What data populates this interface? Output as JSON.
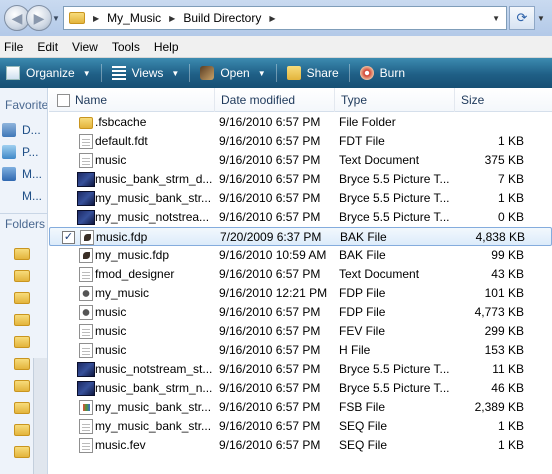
{
  "address_bar": {
    "crumbs": [
      "My_Music",
      "Build Directory"
    ]
  },
  "menu": [
    "File",
    "Edit",
    "View",
    "Tools",
    "Help"
  ],
  "toolbar": {
    "organize": "Organize",
    "views": "Views",
    "open": "Open",
    "share": "Share",
    "burn": "Burn"
  },
  "nav": {
    "favorites_heading": "Favorite L",
    "favorites": [
      "D...",
      "P...",
      "M...",
      "M..."
    ],
    "folders_heading": "Folders"
  },
  "columns": {
    "name": "Name",
    "date": "Date modified",
    "type": "Type",
    "size": "Size"
  },
  "files": [
    {
      "name": ".fsbcache",
      "date": "9/16/2010 6:57 PM",
      "type": "File Folder",
      "size": "",
      "icon": "folder-icon"
    },
    {
      "name": "default.fdt",
      "date": "9/16/2010 6:57 PM",
      "type": "FDT File",
      "size": "1 KB",
      "icon": "document-icon"
    },
    {
      "name": "music",
      "date": "9/16/2010 6:57 PM",
      "type": "Text Document",
      "size": "375 KB",
      "icon": "document-icon"
    },
    {
      "name": "music_bank_strm_d...",
      "date": "9/16/2010 6:57 PM",
      "type": "Bryce 5.5 Picture T...",
      "size": "7 KB",
      "icon": "bryce-picture-icon"
    },
    {
      "name": "my_music_bank_str...",
      "date": "9/16/2010 6:57 PM",
      "type": "Bryce 5.5 Picture T...",
      "size": "1 KB",
      "icon": "bryce-picture-icon"
    },
    {
      "name": "my_music_notstrea...",
      "date": "9/16/2010 6:57 PM",
      "type": "Bryce 5.5 Picture T...",
      "size": "0 KB",
      "icon": "bryce-picture-icon"
    },
    {
      "name": "music.fdp",
      "date": "7/20/2009 6:37 PM",
      "type": "BAK File",
      "size": "4,838 KB",
      "icon": "bak-file-icon",
      "selected": true
    },
    {
      "name": "my_music.fdp",
      "date": "9/16/2010 10:59 AM",
      "type": "BAK File",
      "size": "99 KB",
      "icon": "bak-file-icon"
    },
    {
      "name": "fmod_designer",
      "date": "9/16/2010 6:57 PM",
      "type": "Text Document",
      "size": "43 KB",
      "icon": "document-icon"
    },
    {
      "name": "my_music",
      "date": "9/16/2010 12:21 PM",
      "type": "FDP File",
      "size": "101 KB",
      "icon": "fdp-file-icon"
    },
    {
      "name": "music",
      "date": "9/16/2010 6:57 PM",
      "type": "FDP File",
      "size": "4,773 KB",
      "icon": "fdp-file-icon"
    },
    {
      "name": "music",
      "date": "9/16/2010 6:57 PM",
      "type": "FEV File",
      "size": "299 KB",
      "icon": "document-icon"
    },
    {
      "name": "music",
      "date": "9/16/2010 6:57 PM",
      "type": "H File",
      "size": "153 KB",
      "icon": "document-icon"
    },
    {
      "name": "music_notstream_st...",
      "date": "9/16/2010 6:57 PM",
      "type": "Bryce 5.5 Picture T...",
      "size": "11 KB",
      "icon": "bryce-picture-icon"
    },
    {
      "name": "music_bank_strm_n...",
      "date": "9/16/2010 6:57 PM",
      "type": "Bryce 5.5 Picture T...",
      "size": "46 KB",
      "icon": "bryce-picture-icon"
    },
    {
      "name": "my_music_bank_str...",
      "date": "9/16/2010 6:57 PM",
      "type": "FSB File",
      "size": "2,389 KB",
      "icon": "fsb-file-icon"
    },
    {
      "name": "my_music_bank_str...",
      "date": "9/16/2010 6:57 PM",
      "type": "SEQ File",
      "size": "1 KB",
      "icon": "document-icon"
    },
    {
      "name": "music.fev",
      "date": "9/16/2010 6:57 PM",
      "type": "SEQ File",
      "size": "1 KB",
      "icon": "document-icon"
    }
  ]
}
